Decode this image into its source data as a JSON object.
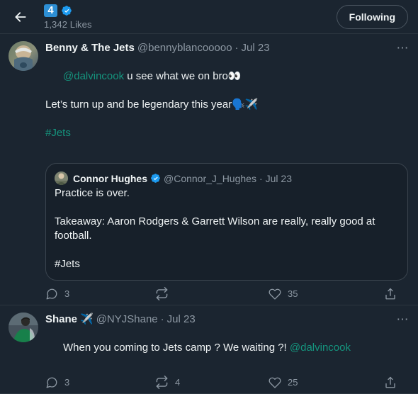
{
  "header": {
    "back_icon": "back-arrow-icon",
    "count_badge": "4",
    "verified_icon": "verified-badge-icon",
    "subtitle": "1,342 Likes",
    "following_label": "Following",
    "accent_blue": "#2d8fd5",
    "link_green": "#15957e"
  },
  "tweets": [
    {
      "avatar": "benny-avatar",
      "display_name": "Benny & The Jets",
      "name_emoji": "",
      "handle": "@bennyblancooooo",
      "separator": "·",
      "date": "Jul 23",
      "more_icon": "more-options-icon",
      "text_parts": [
        {
          "text": "@dalvincook",
          "type": "mention"
        },
        {
          "text": " u see what we on bro👀\n\nLet’s turn up and be legendary this year🗣️✈️\n\n",
          "type": "plain"
        },
        {
          "text": "#Jets",
          "type": "hashtag"
        }
      ],
      "quote": {
        "avatar": "connor-avatar",
        "display_name": "Connor Hughes",
        "verified_icon": "verified-badge-icon",
        "handle": "@Connor_J_Hughes",
        "separator": "·",
        "date": "Jul 23",
        "text": "Practice is over.\n\nTakeaway: Aaron Rodgers & Garrett Wilson are really, really good at football.\n\n#Jets"
      },
      "actions": {
        "reply_icon": "reply-icon",
        "reply_count": "3",
        "retweet_icon": "retweet-icon",
        "retweet_count": "",
        "like_icon": "like-heart-icon",
        "like_count": "35",
        "share_icon": "share-icon"
      }
    },
    {
      "avatar": "shane-avatar",
      "display_name": "Shane",
      "name_emoji": "✈️",
      "handle": "@NYJShane",
      "separator": "·",
      "date": "Jul 23",
      "more_icon": "more-options-icon",
      "text_parts": [
        {
          "text": "When you coming to Jets camp ? We waiting ?! ",
          "type": "plain"
        },
        {
          "text": "@dalvincook",
          "type": "mention"
        }
      ],
      "quote": null,
      "actions": {
        "reply_icon": "reply-icon",
        "reply_count": "3",
        "retweet_icon": "retweet-icon",
        "retweet_count": "4",
        "like_icon": "like-heart-icon",
        "like_count": "25",
        "share_icon": "share-icon"
      }
    }
  ]
}
